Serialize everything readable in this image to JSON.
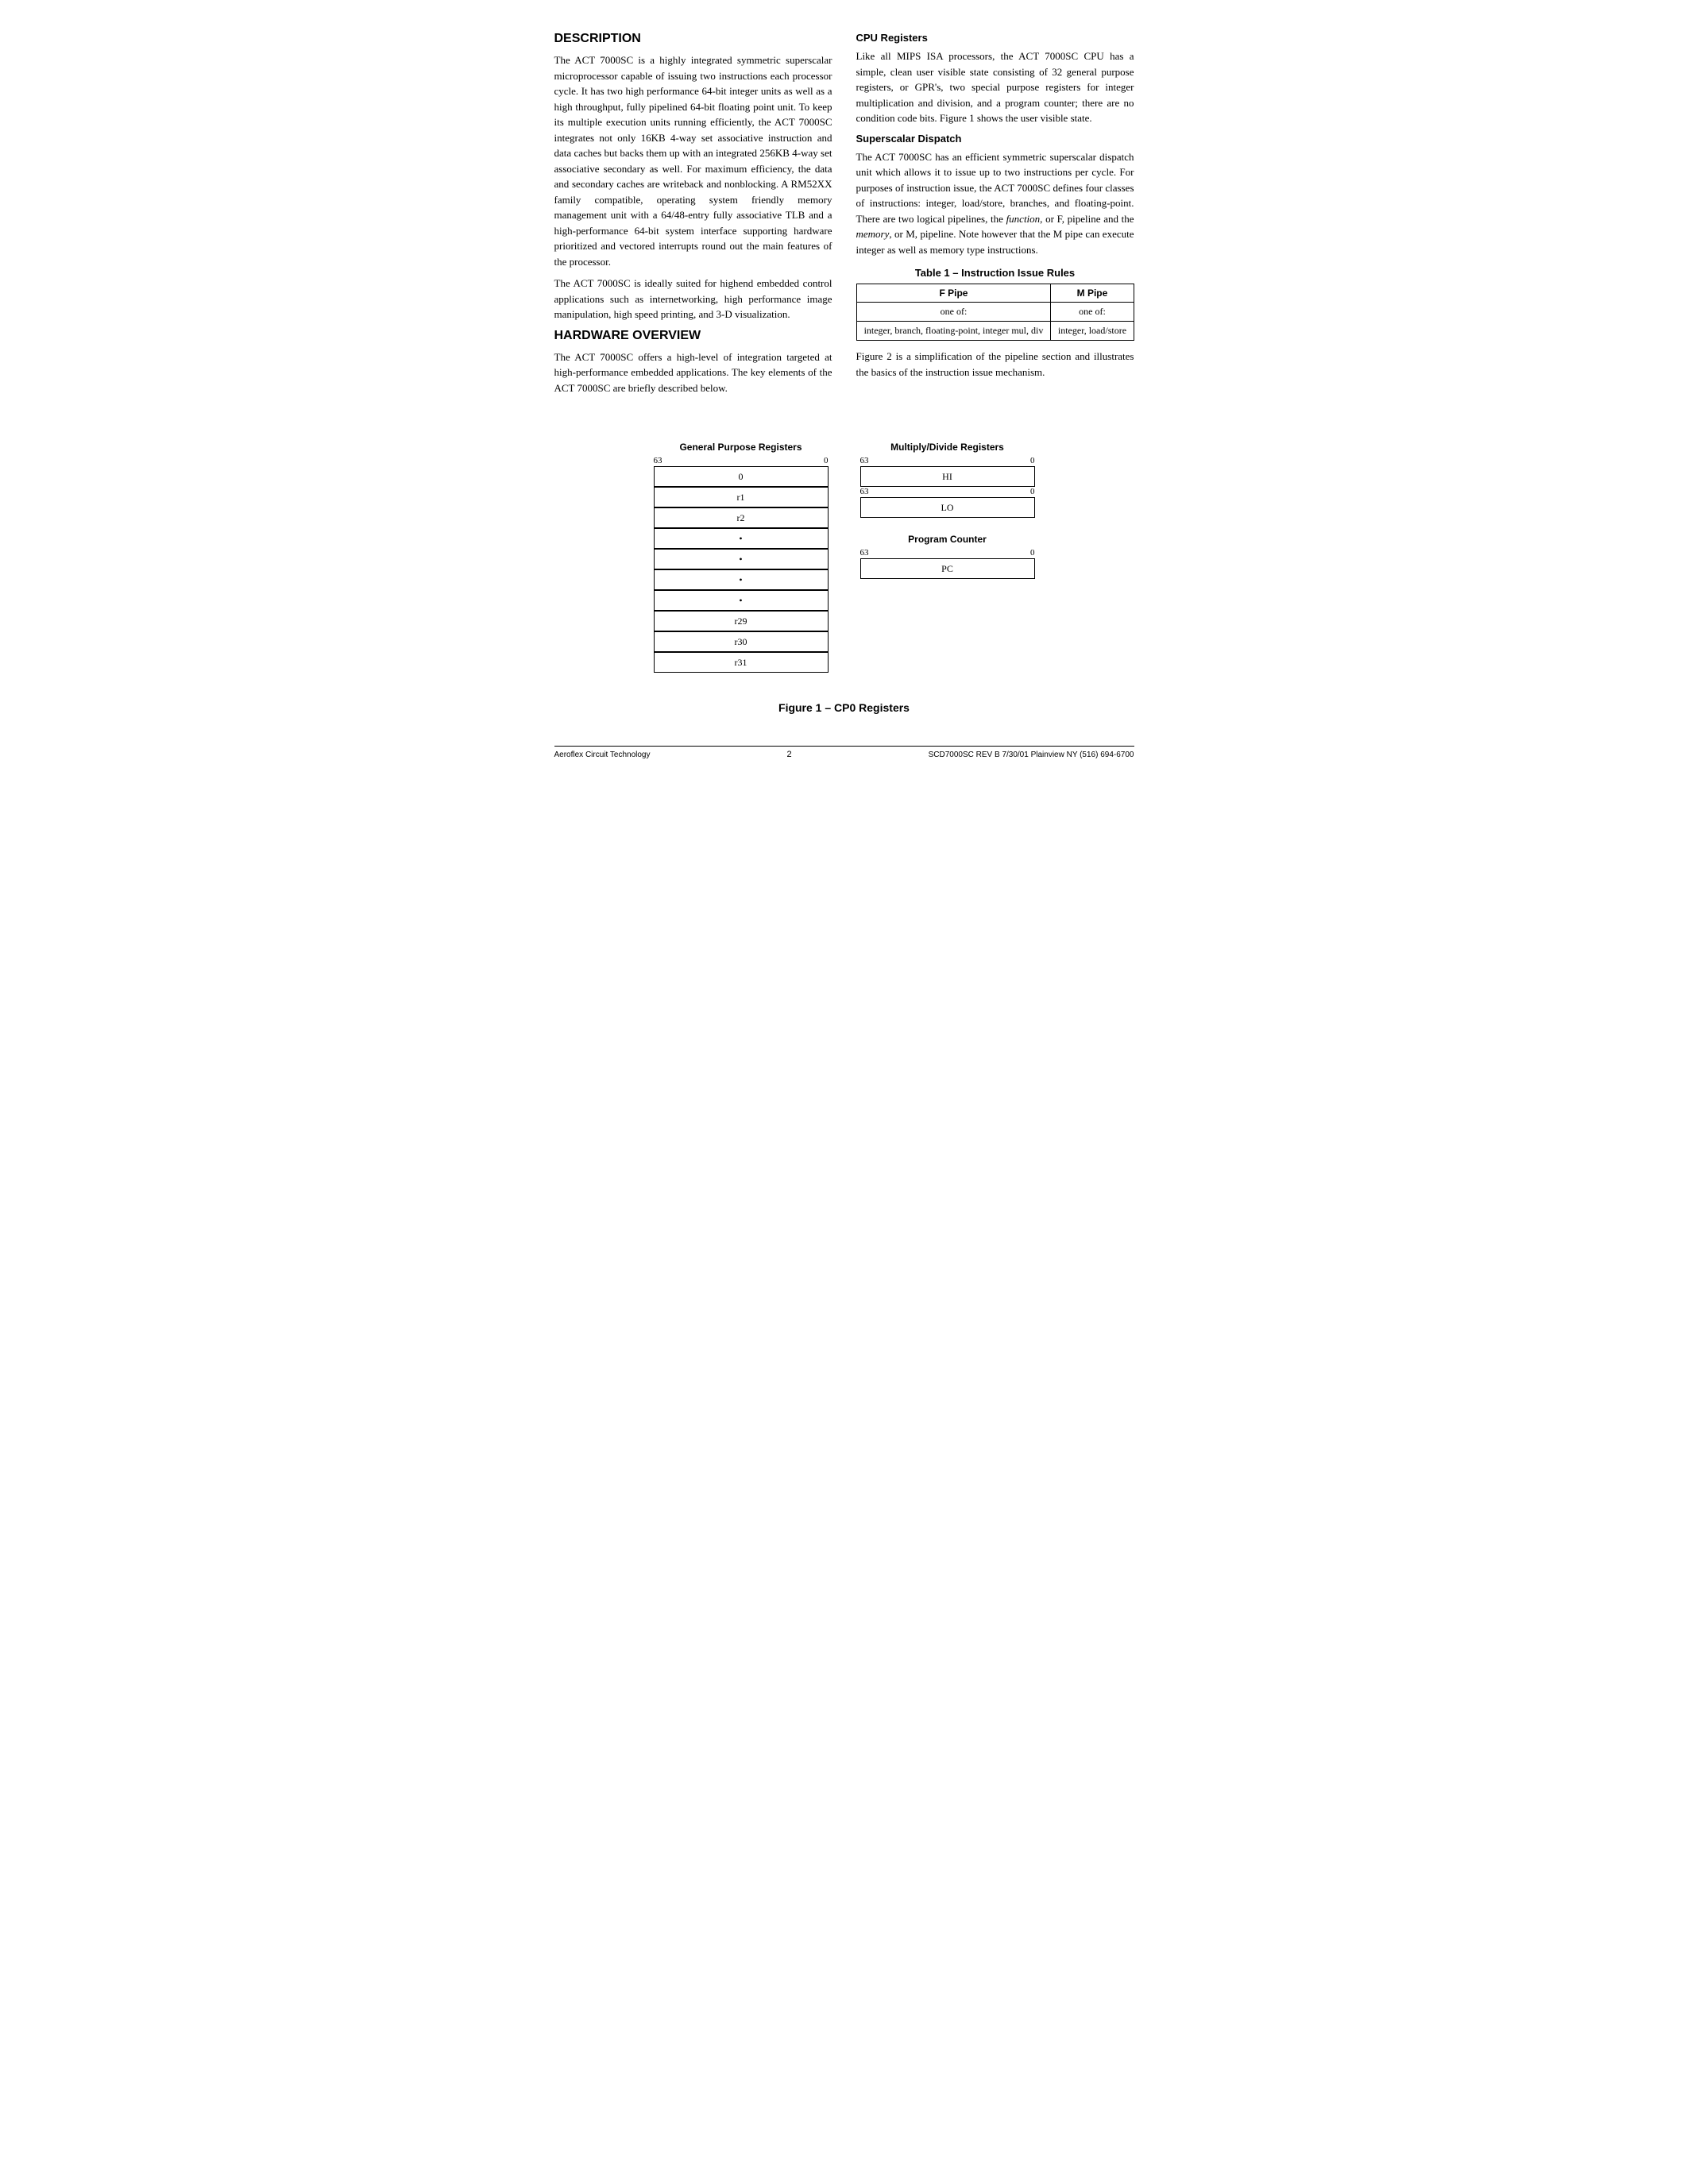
{
  "page": {
    "sections": {
      "description": {
        "title": "DESCRIPTION",
        "paragraphs": [
          "The ACT 7000SC is a highly integrated symmetric superscalar microprocessor capable of issuing two instructions each processor cycle. It has two high performance 64-bit integer units as well as a high throughput, fully pipelined 64-bit floating point unit. To keep its multiple execution units running efficiently, the ACT 7000SC integrates not only 16KB 4-way set associative instruction and data caches but backs them up with an integrated 256KB 4-way set associative secondary as well. For maximum efficiency, the data and secondary caches are writeback and nonblocking. A RM52XX family compatible, operating system friendly memory management unit with a 64/48-entry fully associative TLB and a high-performance 64-bit system interface supporting hardware prioritized and vectored interrupts round out the main features of the processor.",
          "The ACT 7000SC is ideally suited for highend embedded control applications such as internetworking, high performance image manipulation, high speed printing, and 3-D visualization."
        ]
      },
      "hardware_overview": {
        "title": "HARDWARE OVERVIEW",
        "paragraph": "The ACT 7000SC offers a high-level of integration targeted at high-performance embedded applications. The key elements of the ACT 7000SC are briefly described below."
      },
      "cpu_registers": {
        "title": "CPU Registers",
        "paragraph": "Like all MIPS ISA processors, the ACT 7000SC CPU has a simple, clean user visible state consisting of 32 general purpose registers, or GPR's, two special purpose registers for integer multiplication and division, and a program counter; there are no condition code bits. Figure 1 shows the user visible state."
      },
      "superscalar_dispatch": {
        "title": "Superscalar Dispatch",
        "paragraph": "The ACT 7000SC has an efficient symmetric superscalar dispatch unit which allows it to issue up to two instructions per cycle. For purposes of instruction issue, the ACT 7000SC defines four classes of instructions: integer, load/store, branches, and floating-point. There are two logical pipelines, the function, or F, pipeline and the memory, or M, pipeline. Note however that the M pipe can execute integer as well as memory type instructions."
      },
      "table": {
        "caption": "Table 1 – Instruction Issue Rules",
        "headers": [
          "F Pipe",
          "M Pipe"
        ],
        "rows": [
          [
            "one of:",
            "one of:"
          ],
          [
            "integer, branch, floating-point, integer mul, div",
            "integer, load/store"
          ]
        ]
      },
      "figure_note": "Figure 2 is a simplification of the pipeline section and illustrates the basics of the instruction issue mechanism."
    },
    "figure": {
      "gpr": {
        "title": "General Purpose Registers",
        "bit_high": "63",
        "bit_low": "0",
        "registers": [
          "0",
          "r1",
          "r2",
          "•",
          "•",
          "•",
          "•",
          "r29",
          "r30",
          "r31"
        ]
      },
      "multiply_divide": {
        "title": "Multiply/Divide Registers",
        "bit_high": "63",
        "bit_low": "0",
        "registers": [
          {
            "label": "HI",
            "bit_high": "63",
            "bit_low": "0"
          },
          {
            "label": "LO",
            "bit_high": "63",
            "bit_low": "0"
          }
        ]
      },
      "program_counter": {
        "title": "Program Counter",
        "bit_high": "63",
        "bit_low": "0",
        "register_label": "PC"
      },
      "caption": "Figure 1 – CP0 Registers"
    },
    "footer": {
      "left": "Aeroflex Circuit Technology",
      "center": "2",
      "right": "SCD7000SC REV B  7/30/01 Plainview NY (516) 694-6700"
    }
  }
}
